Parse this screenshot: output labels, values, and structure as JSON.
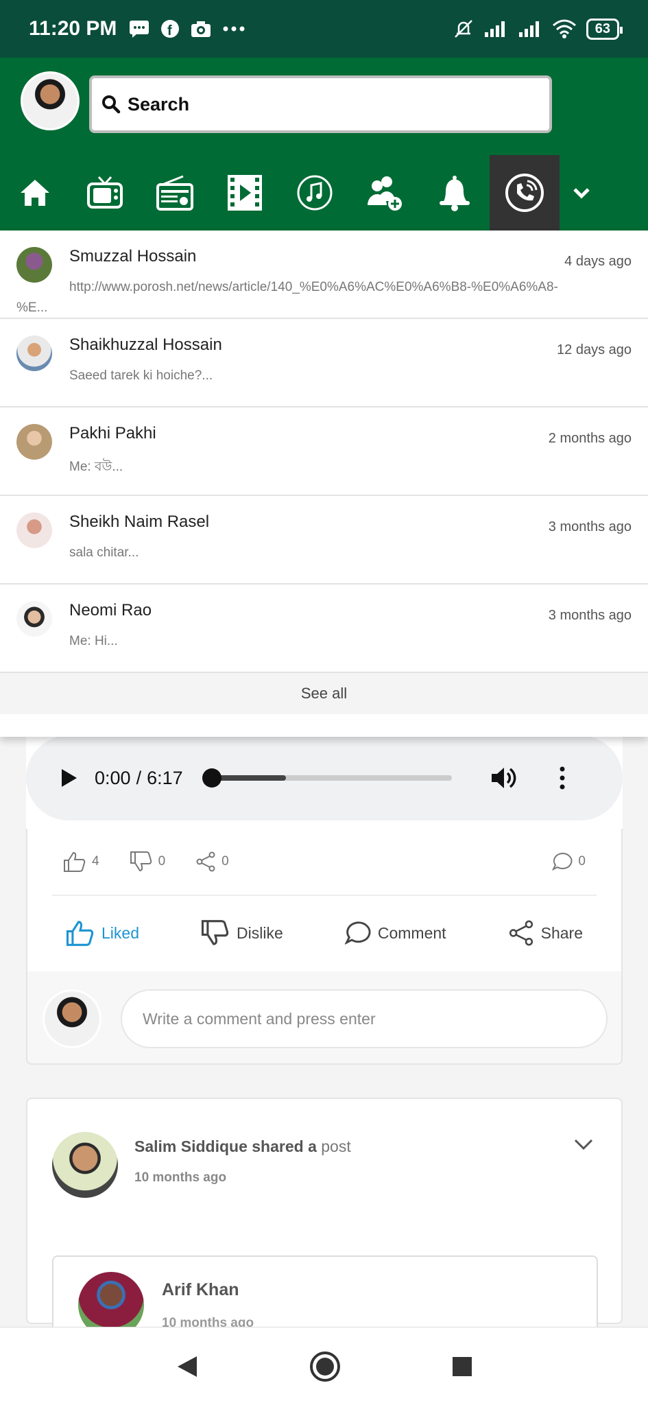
{
  "status_bar": {
    "time": "11:20 PM",
    "battery": "63",
    "left_icons": [
      "messages-icon",
      "facebook-icon",
      "camera-icon",
      "more-icon"
    ],
    "right_icons": [
      "mute-icon",
      "signal-icon",
      "signal-icon",
      "wifi-icon"
    ]
  },
  "header": {
    "search": {
      "label": "Search"
    },
    "nav": [
      {
        "name": "home",
        "icon": "home-icon"
      },
      {
        "name": "tv",
        "icon": "tv-icon"
      },
      {
        "name": "radio",
        "icon": "radio-icon"
      },
      {
        "name": "video",
        "icon": "video-icon"
      },
      {
        "name": "music",
        "icon": "music-icon"
      },
      {
        "name": "friends",
        "icon": "add-friend-icon"
      },
      {
        "name": "notifications",
        "icon": "bell-icon"
      },
      {
        "name": "calls",
        "icon": "phone-icon",
        "active": true
      },
      {
        "name": "more",
        "icon": "chevron-down-icon"
      }
    ]
  },
  "dropdown": {
    "messages": [
      {
        "name": "Smuzzal Hossain",
        "time": "4 days ago",
        "preview": "http://www.porosh.net/news/article/140_%E0%A6%AC%E0%A6%B8-%E0%A6%A8-",
        "preview_more": "%E..."
      },
      {
        "name": "Shaikhuzzal Hossain",
        "time": "12 days ago",
        "preview": "Saeed tarek ki hoiche?..."
      },
      {
        "name": "Pakhi Pakhi",
        "time": "2 months ago",
        "preview": "Me: বউ..."
      },
      {
        "name": "Sheikh Naim Rasel",
        "time": "3 months ago",
        "preview": "sala chitar..."
      },
      {
        "name": "Neomi Rao",
        "time": "3 months ago",
        "preview": "Me: Hi..."
      }
    ],
    "see_all": "See all"
  },
  "audio": {
    "current": "0:00",
    "separator": "/",
    "duration": "6:17",
    "progress": 0.0,
    "buffered": 0.32
  },
  "stats": {
    "likes": "4",
    "dislikes": "0",
    "shares": "0",
    "comments": "0"
  },
  "actions": {
    "liked": "Liked",
    "dislike": "Dislike",
    "comment": "Comment",
    "share": "Share"
  },
  "comment_input": {
    "placeholder": "Write a comment and press enter"
  },
  "post": {
    "author": "Salim Siddique",
    "shared_a": "shared a",
    "link": "post",
    "time": "10 months ago",
    "inner_author": "Arif Khan",
    "inner_time": "10 months ago"
  },
  "colors": {
    "header_green": "#006b34",
    "status_green": "#0a4d3a",
    "liked_blue": "#1c94d2"
  }
}
